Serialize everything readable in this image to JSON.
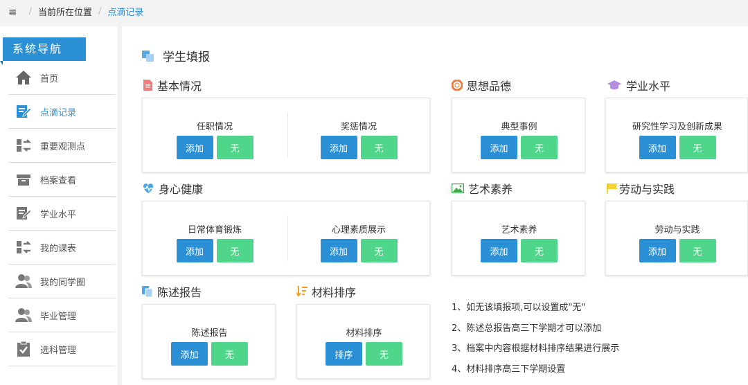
{
  "breadcrumb": {
    "menu_icon": "≡",
    "items": [
      "当前所在位置",
      "点滴记录"
    ]
  },
  "sidebar": {
    "title": "系统导航",
    "items": [
      {
        "label": "首页",
        "icon": "home-icon"
      },
      {
        "label": "点滴记录",
        "icon": "edit-icon",
        "active": true
      },
      {
        "label": "重要观测点",
        "icon": "swap-icon"
      },
      {
        "label": "档案查看",
        "icon": "archive-box-icon"
      },
      {
        "label": "学业水平",
        "icon": "edit-icon"
      },
      {
        "label": "我的课表",
        "icon": "swap-icon"
      },
      {
        "label": "我的同学圈",
        "icon": "users-icon"
      },
      {
        "label": "毕业管理",
        "icon": "users-icon"
      },
      {
        "label": "选科管理",
        "icon": "clipboard-check-icon"
      }
    ]
  },
  "main": {
    "title": "学生填报",
    "sections": {
      "basic": {
        "title": "基本情况",
        "items": [
          {
            "name": "任职情况",
            "btn1": "添加",
            "btn2": "无"
          },
          {
            "name": "奖惩情况",
            "btn1": "添加",
            "btn2": "无"
          }
        ]
      },
      "moral": {
        "title": "思想品德",
        "items": [
          {
            "name": "典型事例",
            "btn1": "添加",
            "btn2": "无"
          }
        ]
      },
      "academic": {
        "title": "学业水平",
        "items": [
          {
            "name": "研究性学习及创新成果",
            "btn1": "添加",
            "btn2": "无"
          }
        ]
      },
      "health": {
        "title": "身心健康",
        "items": [
          {
            "name": "日常体育锻炼",
            "btn1": "添加",
            "btn2": "无"
          },
          {
            "name": "心理素质展示",
            "btn1": "添加",
            "btn2": "无"
          }
        ]
      },
      "art": {
        "title": "艺术素养",
        "items": [
          {
            "name": "艺术素养",
            "btn1": "添加",
            "btn2": "无"
          }
        ]
      },
      "labor": {
        "title": "劳动与实践",
        "items": [
          {
            "name": "劳动与实践",
            "btn1": "添加",
            "btn2": "无"
          }
        ]
      },
      "report": {
        "title": "陈述报告",
        "items": [
          {
            "name": "陈述报告",
            "btn1": "添加",
            "btn2": "无"
          }
        ]
      },
      "sort": {
        "title": "材料排序",
        "items": [
          {
            "name": "材料排序",
            "btn1": "排序",
            "btn2": "无"
          }
        ]
      }
    },
    "notes": [
      "1、如无该填报项,可以设置成\"无\"",
      "2、陈述总报告高三下学期才可以添加",
      "3、档案中内容根据材料排序结果进行展示",
      "4、材料排序高三下学期设置"
    ]
  },
  "colors": {
    "primary": "#2b8fd6",
    "success": "#4fd68b"
  }
}
